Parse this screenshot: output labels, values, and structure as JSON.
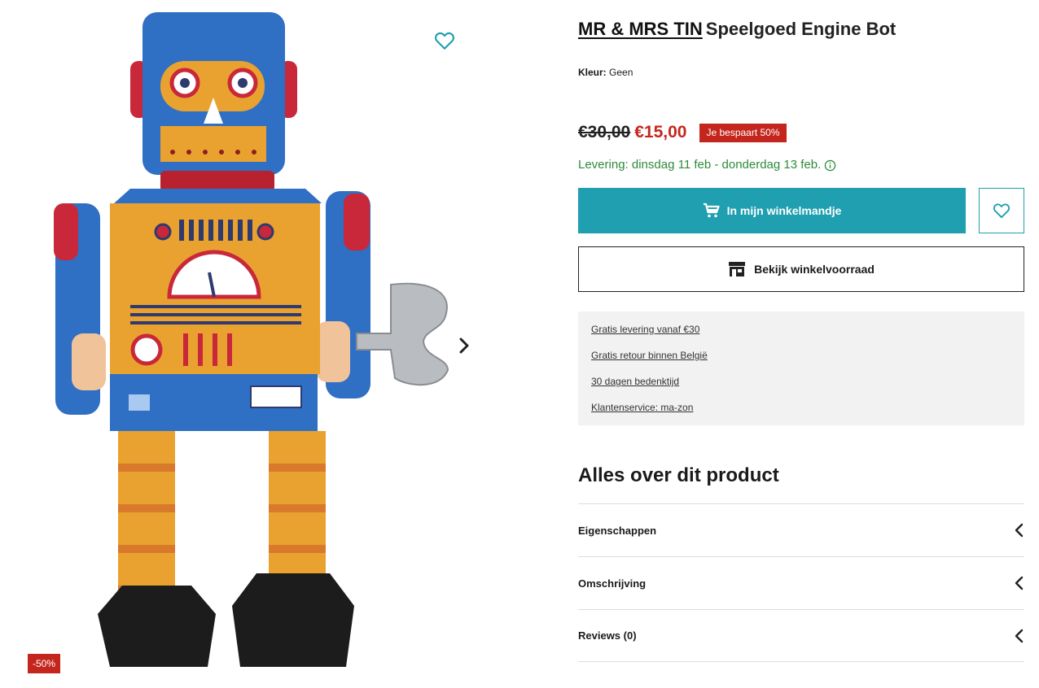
{
  "product": {
    "brand": "MR & MRS TIN",
    "name": "Speelgoed Engine Bot",
    "color_label": "Kleur:",
    "color_value": "Geen",
    "old_price": "€30,00",
    "new_price": "€15,00",
    "savings_badge": "Je bespaart 50%",
    "delivery": "Levering: dinsdag 11 feb - donderdag 13 feb.",
    "discount_tag": "-50%"
  },
  "actions": {
    "cart_label": "In mijn winkelmandje",
    "store_label": "Bekijk winkelvoorraad"
  },
  "usps": [
    "Gratis levering vanaf €30",
    "Gratis retour binnen België",
    "30 dagen bedenktijd",
    "Klantenservice: ma-zon"
  ],
  "details": {
    "title": "Alles over dit product",
    "sections": [
      "Eigenschappen",
      "Omschrijving",
      "Reviews (0)"
    ]
  },
  "colors": {
    "accent": "#1f9fb0",
    "sale": "#c4261d",
    "delivery": "#2e8b3a"
  },
  "icons": [
    "heart-icon",
    "chevron-right-icon",
    "cart-icon",
    "store-icon",
    "info-icon",
    "chevron-left-icon"
  ]
}
